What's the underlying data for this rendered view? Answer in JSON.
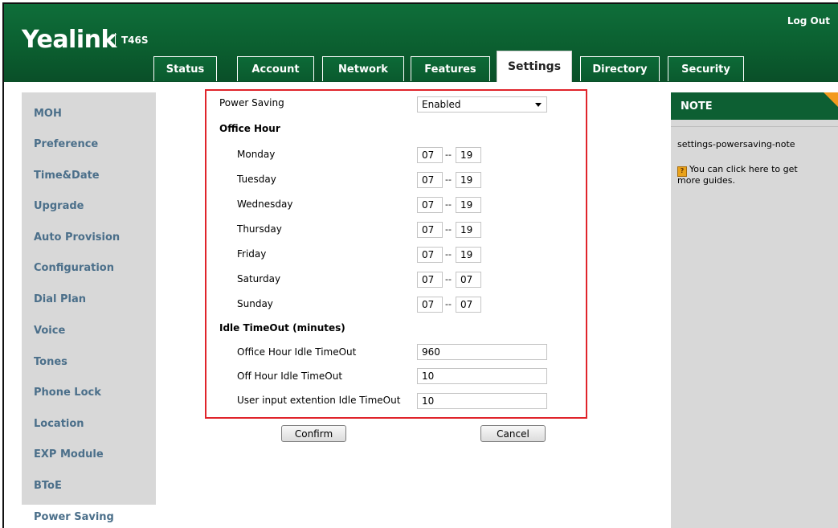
{
  "header": {
    "brand": "Yealink",
    "model": "T46S",
    "logout": "Log Out"
  },
  "tabs": [
    {
      "label": "Status"
    },
    {
      "label": "Account"
    },
    {
      "label": "Network"
    },
    {
      "label": "Features"
    },
    {
      "label": "Settings"
    },
    {
      "label": "Directory"
    },
    {
      "label": "Security"
    }
  ],
  "active_tab": "Settings",
  "sidebar": {
    "items": [
      {
        "label": "MOH"
      },
      {
        "label": "Preference"
      },
      {
        "label": "Time&Date"
      },
      {
        "label": "Upgrade"
      },
      {
        "label": "Auto Provision"
      },
      {
        "label": "Configuration"
      },
      {
        "label": "Dial Plan"
      },
      {
        "label": "Voice"
      },
      {
        "label": "Tones"
      },
      {
        "label": "Phone Lock"
      },
      {
        "label": "Location"
      },
      {
        "label": "EXP Module"
      },
      {
        "label": "BToE"
      },
      {
        "label": "Power Saving"
      }
    ],
    "active": "Power Saving"
  },
  "form": {
    "power_saving_label": "Power Saving",
    "power_saving_value": "Enabled",
    "office_hour_heading": "Office Hour",
    "range_separator": "--",
    "days": [
      {
        "label": "Monday",
        "start": "07",
        "end": "19"
      },
      {
        "label": "Tuesday",
        "start": "07",
        "end": "19"
      },
      {
        "label": "Wednesday",
        "start": "07",
        "end": "19"
      },
      {
        "label": "Thursday",
        "start": "07",
        "end": "19"
      },
      {
        "label": "Friday",
        "start": "07",
        "end": "19"
      },
      {
        "label": "Saturday",
        "start": "07",
        "end": "07"
      },
      {
        "label": "Sunday",
        "start": "07",
        "end": "07"
      }
    ],
    "idle_heading": "Idle TimeOut (minutes)",
    "idle": [
      {
        "label": "Office Hour Idle TimeOut",
        "value": "960"
      },
      {
        "label": "Off Hour Idle TimeOut",
        "value": "10"
      },
      {
        "label": "User input extention Idle TimeOut",
        "value": "10"
      }
    ],
    "confirm_label": "Confirm",
    "cancel_label": "Cancel"
  },
  "note": {
    "title": "NOTE",
    "text": "settings-powersaving-note",
    "guide_icon": "?",
    "guide_line1": "You can click here to get",
    "guide_line2": "more guides."
  },
  "colors": {
    "header_green": "#0b5f30",
    "highlight_red": "#e0242b",
    "sidebar_text": "#4b6f8a",
    "note_corner": "#f39a1e"
  }
}
